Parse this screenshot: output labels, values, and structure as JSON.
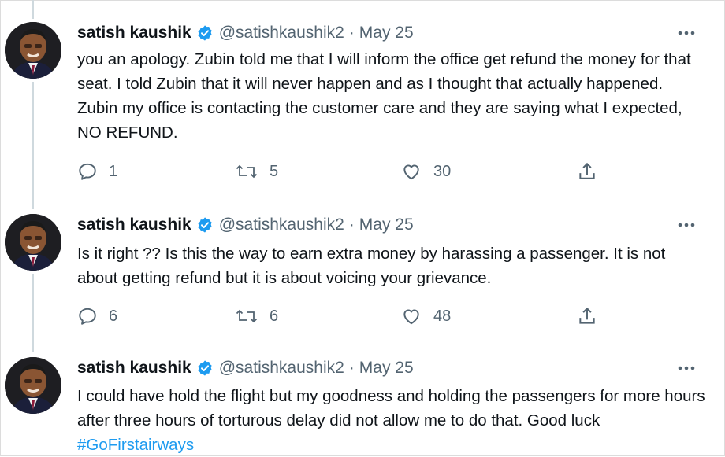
{
  "tweets": [
    {
      "author_name": "satish kaushik",
      "handle": "@satishkaushik2",
      "separator": "·",
      "date": "May 25",
      "text": "you an apology. Zubin told me that I will inform the office get refund the money for that seat. I told Zubin that it will never happen and as I thought that actually happened. Zubin my office is contacting the customer care and they are saying what I expected, NO REFUND.",
      "replies": "1",
      "retweets": "5",
      "likes": "30"
    },
    {
      "author_name": "satish kaushik",
      "handle": "@satishkaushik2",
      "separator": "·",
      "date": "May 25",
      "text": "Is it right ?? Is this the way to earn extra money by harassing a passenger. It is not about getting refund but it is about voicing your grievance.",
      "replies": "6",
      "retweets": "6",
      "likes": "48"
    },
    {
      "author_name": "satish kaushik",
      "handle": "@satishkaushik2",
      "separator": "·",
      "date": "May 25",
      "text": "I could have hold the flight but my goodness and holding the passengers for more hours after three hours of torturous delay did not allow me to do that. Good luck ",
      "hashtag": "#GoFirstairways"
    }
  ],
  "colors": {
    "accent": "#1d9bf0",
    "secondary_text": "#536471",
    "primary_text": "#0f1419"
  },
  "icons": [
    "verified-badge-icon",
    "more-options-icon",
    "reply-icon",
    "retweet-icon",
    "like-icon",
    "share-icon"
  ]
}
